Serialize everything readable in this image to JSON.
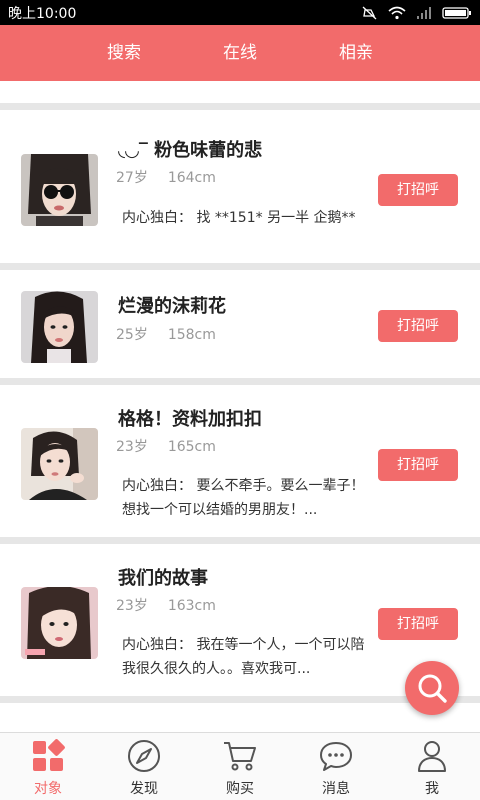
{
  "status_bar": {
    "time": "晚上10:00"
  },
  "top_tabs": [
    {
      "label": "搜索"
    },
    {
      "label": "在线"
    },
    {
      "label": "相亲"
    }
  ],
  "profiles": [
    {
      "name": "◟◡‾ 粉色味蕾的悲",
      "age": "27岁",
      "height": "164cm",
      "bio": "内心独白： 找 **151* 另一半 企鹅**",
      "greet_label": "打招呼"
    },
    {
      "name": "烂漫的沫莉花",
      "age": "25岁",
      "height": "158cm",
      "bio": "",
      "greet_label": "打招呼"
    },
    {
      "name": "格格！资料加扣扣",
      "age": "23岁",
      "height": "165cm",
      "bio": "内心独白： 要么不牵手。要么一辈子！想找一个可以结婚的男朋友！...",
      "greet_label": "打招呼"
    },
    {
      "name": "我们的故事",
      "age": "23岁",
      "height": "163cm",
      "bio": "内心独白： 我在等一个人，一个可以陪我很久很久的人。。喜欢我可...",
      "greet_label": "打招呼"
    }
  ],
  "bottom_nav": [
    {
      "label": "对象",
      "icon": "grid-icon",
      "active": true
    },
    {
      "label": "发现",
      "icon": "compass-icon"
    },
    {
      "label": "购买",
      "icon": "cart-icon"
    },
    {
      "label": "消息",
      "icon": "chat-bubble-icon"
    },
    {
      "label": "我",
      "icon": "person-icon"
    }
  ],
  "colors": {
    "accent": "#f26b6b",
    "divider": "#e3e3e3"
  }
}
